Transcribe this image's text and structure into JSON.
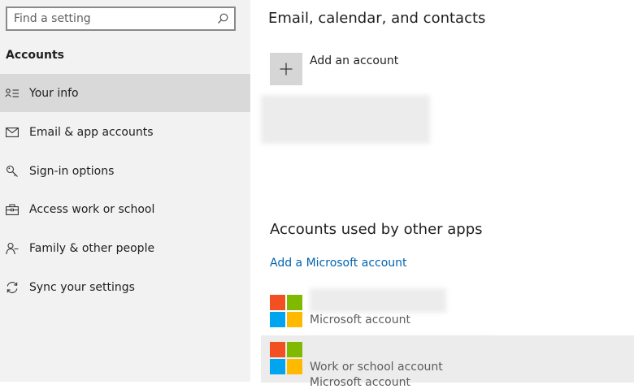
{
  "search": {
    "placeholder": "Find a setting"
  },
  "sidebar": {
    "section_label": "Accounts",
    "items": [
      {
        "label": "Your info",
        "icon": "person-info-icon",
        "active": true
      },
      {
        "label": "Email & app accounts",
        "icon": "mail-icon"
      },
      {
        "label": "Sign-in options",
        "icon": "key-icon"
      },
      {
        "label": "Access work or school",
        "icon": "briefcase-icon"
      },
      {
        "label": "Family & other people",
        "icon": "people-icon"
      },
      {
        "label": "Sync your settings",
        "icon": "sync-icon"
      }
    ]
  },
  "main": {
    "email_section_title": "Email, calendar, and contacts",
    "add_account_label": "Add an account",
    "other_apps_title": "Accounts used by other apps",
    "add_microsoft_link": "Add a Microsoft account",
    "accounts": [
      {
        "type": "Microsoft account"
      },
      {
        "type": "Work or school account",
        "extra": "Microsoft account"
      }
    ]
  },
  "colors": {
    "accent": "#0063b1",
    "ms_red": "#f25022",
    "ms_green": "#7fba00",
    "ms_blue": "#00a4ef",
    "ms_yellow": "#ffb900"
  }
}
